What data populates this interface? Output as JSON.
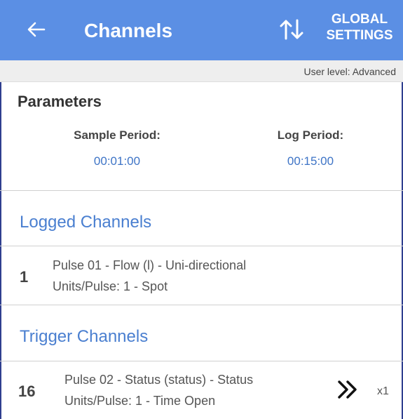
{
  "header": {
    "title": "Channels",
    "global_settings_line1": "GLOBAL",
    "global_settings_line2": "SETTINGS",
    "icons": {
      "back": "back-arrow-icon",
      "sort": "sort-arrows-icon"
    },
    "background_color": "#5b8fe4"
  },
  "user_level": "User level: Advanced",
  "parameters": {
    "title": "Parameters",
    "sample_period": {
      "label": "Sample Period:",
      "value": "00:01:00"
    },
    "log_period": {
      "label": "Log Period:",
      "value": "00:15:00"
    }
  },
  "logged_channels": {
    "title": "Logged Channels",
    "items": [
      {
        "number": "1",
        "line1": "Pulse 01 - Flow (l) - Uni-directional",
        "line2": "Units/Pulse: 1 - Spot"
      }
    ]
  },
  "trigger_channels": {
    "title": "Trigger Channels",
    "items": [
      {
        "number": "16",
        "line1": "Pulse 02 - Status (status) - Status",
        "line2": "Units/Pulse: 1 - Time Open",
        "multiplier": "x1",
        "icon": "double-chevron-right-icon"
      }
    ]
  },
  "colors": {
    "accent": "#5b8fe4",
    "link_blue": "#3e74c6",
    "section_blue": "#4a7fd0"
  }
}
